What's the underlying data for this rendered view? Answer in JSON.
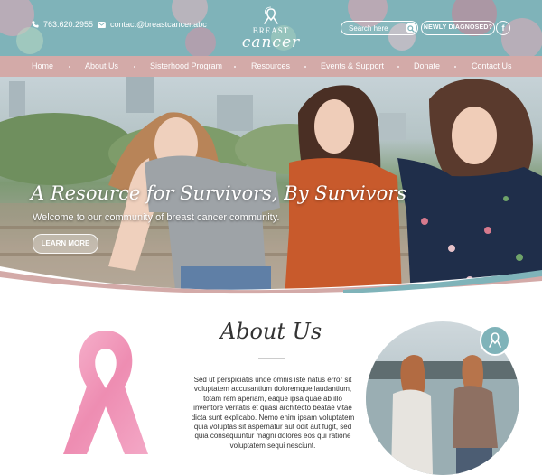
{
  "header": {
    "phone": "763.620.2955",
    "email": "contact@breastcancer.abc",
    "logo": {
      "line1": "BREAST",
      "line2": "cancer"
    },
    "search_placeholder": "Search here",
    "newly_diagnosed_label": "NEWLY DIAGNOSED?",
    "facebook_label": "f"
  },
  "nav": {
    "items": [
      {
        "label": "Home"
      },
      {
        "label": "About Us"
      },
      {
        "label": "Sisterhood Program"
      },
      {
        "label": "Resources"
      },
      {
        "label": "Events & Support"
      },
      {
        "label": "Donate"
      },
      {
        "label": "Contact Us"
      }
    ]
  },
  "hero": {
    "title": "A Resource for Survivors, By Survivors",
    "subtitle": "Welcome to our community of breast cancer community.",
    "button_label": "LEARN MORE"
  },
  "about": {
    "title": "About Us",
    "body": "Sed ut perspiciatis unde omnis iste natus error sit voluptatem accusantium doloremque laudantium, totam rem aperiam, eaque ipsa quae ab illo inventore veritatis et quasi architecto beatae vitae dicta sunt explicabo. Nemo enim ipsam voluptatem quia voluptas sit aspernatur aut odit aut fugit, sed quia consequuntur magni dolores eos qui ratione voluptatem sequi nesciunt."
  },
  "colors": {
    "topbar": "#7fb3b9",
    "nav": "#d3aaa8",
    "ribbon": "#f09cbf",
    "text": "#333333"
  },
  "icons": {
    "phone": "phone-icon",
    "email": "envelope-icon",
    "search": "search-icon",
    "facebook": "facebook-icon",
    "ribbon": "awareness-ribbon-icon"
  }
}
